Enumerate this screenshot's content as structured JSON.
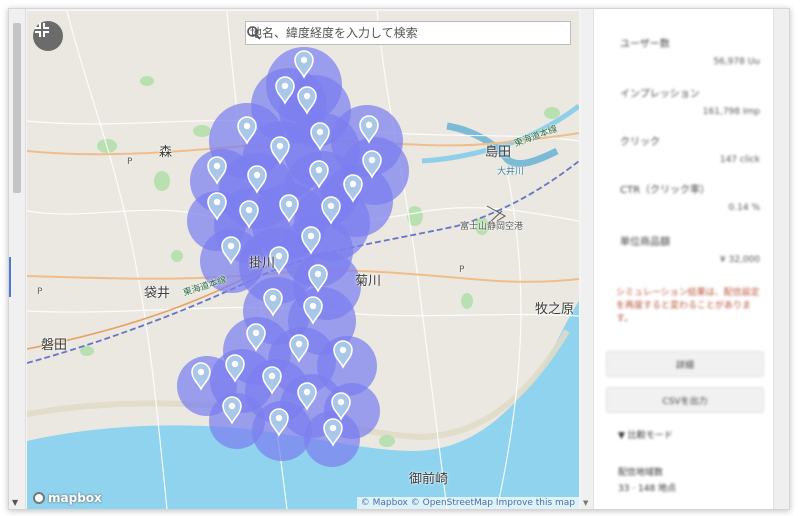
{
  "map": {
    "search_placeholder": "地名、緯度経度を入力して検索",
    "search_icon": "search-icon",
    "fullscreen_icon": "exit-fullscreen-icon",
    "logo": "mapbox",
    "attribution": "© Mapbox © OpenStreetMap Improve this map",
    "coverage_color": "#7b7ef0",
    "pin_color": "#a9c7e8",
    "labels": {
      "mori": "森",
      "shimada": "島田",
      "kakegawa": "掛川",
      "fukuroi": "袋井",
      "kikugawa": "菊川",
      "makinohara": "牧之原",
      "iwata": "磐田",
      "omaezaki": "御前崎",
      "airport": "富士山静岡空港",
      "oigawa": "大井川",
      "tokaido_east": "東海道本線",
      "tokaido_west": "東海道本線",
      "p1": "P",
      "p2": "P",
      "p3": "P"
    }
  },
  "panel": {
    "stats": [
      {
        "label": "ユーザー数",
        "value": "56,978 Uu"
      },
      {
        "label": "インプレッション",
        "value": "161,798 Imp"
      },
      {
        "label": "クリック",
        "value": "147 click"
      },
      {
        "label": "CTR（クリック率）",
        "value": "0.14 %"
      },
      {
        "label": "単位商品額",
        "value": "¥ 32,000"
      }
    ],
    "warning": "シミュレーション結果は、配信設定を再度すると変わることがあります。",
    "primary_button": "詳細",
    "secondary_button": "CSVを出力",
    "collapse_label": "▼ 比較モード",
    "meta_title": "配信地域数",
    "meta_value": "33 · 148 地点"
  }
}
